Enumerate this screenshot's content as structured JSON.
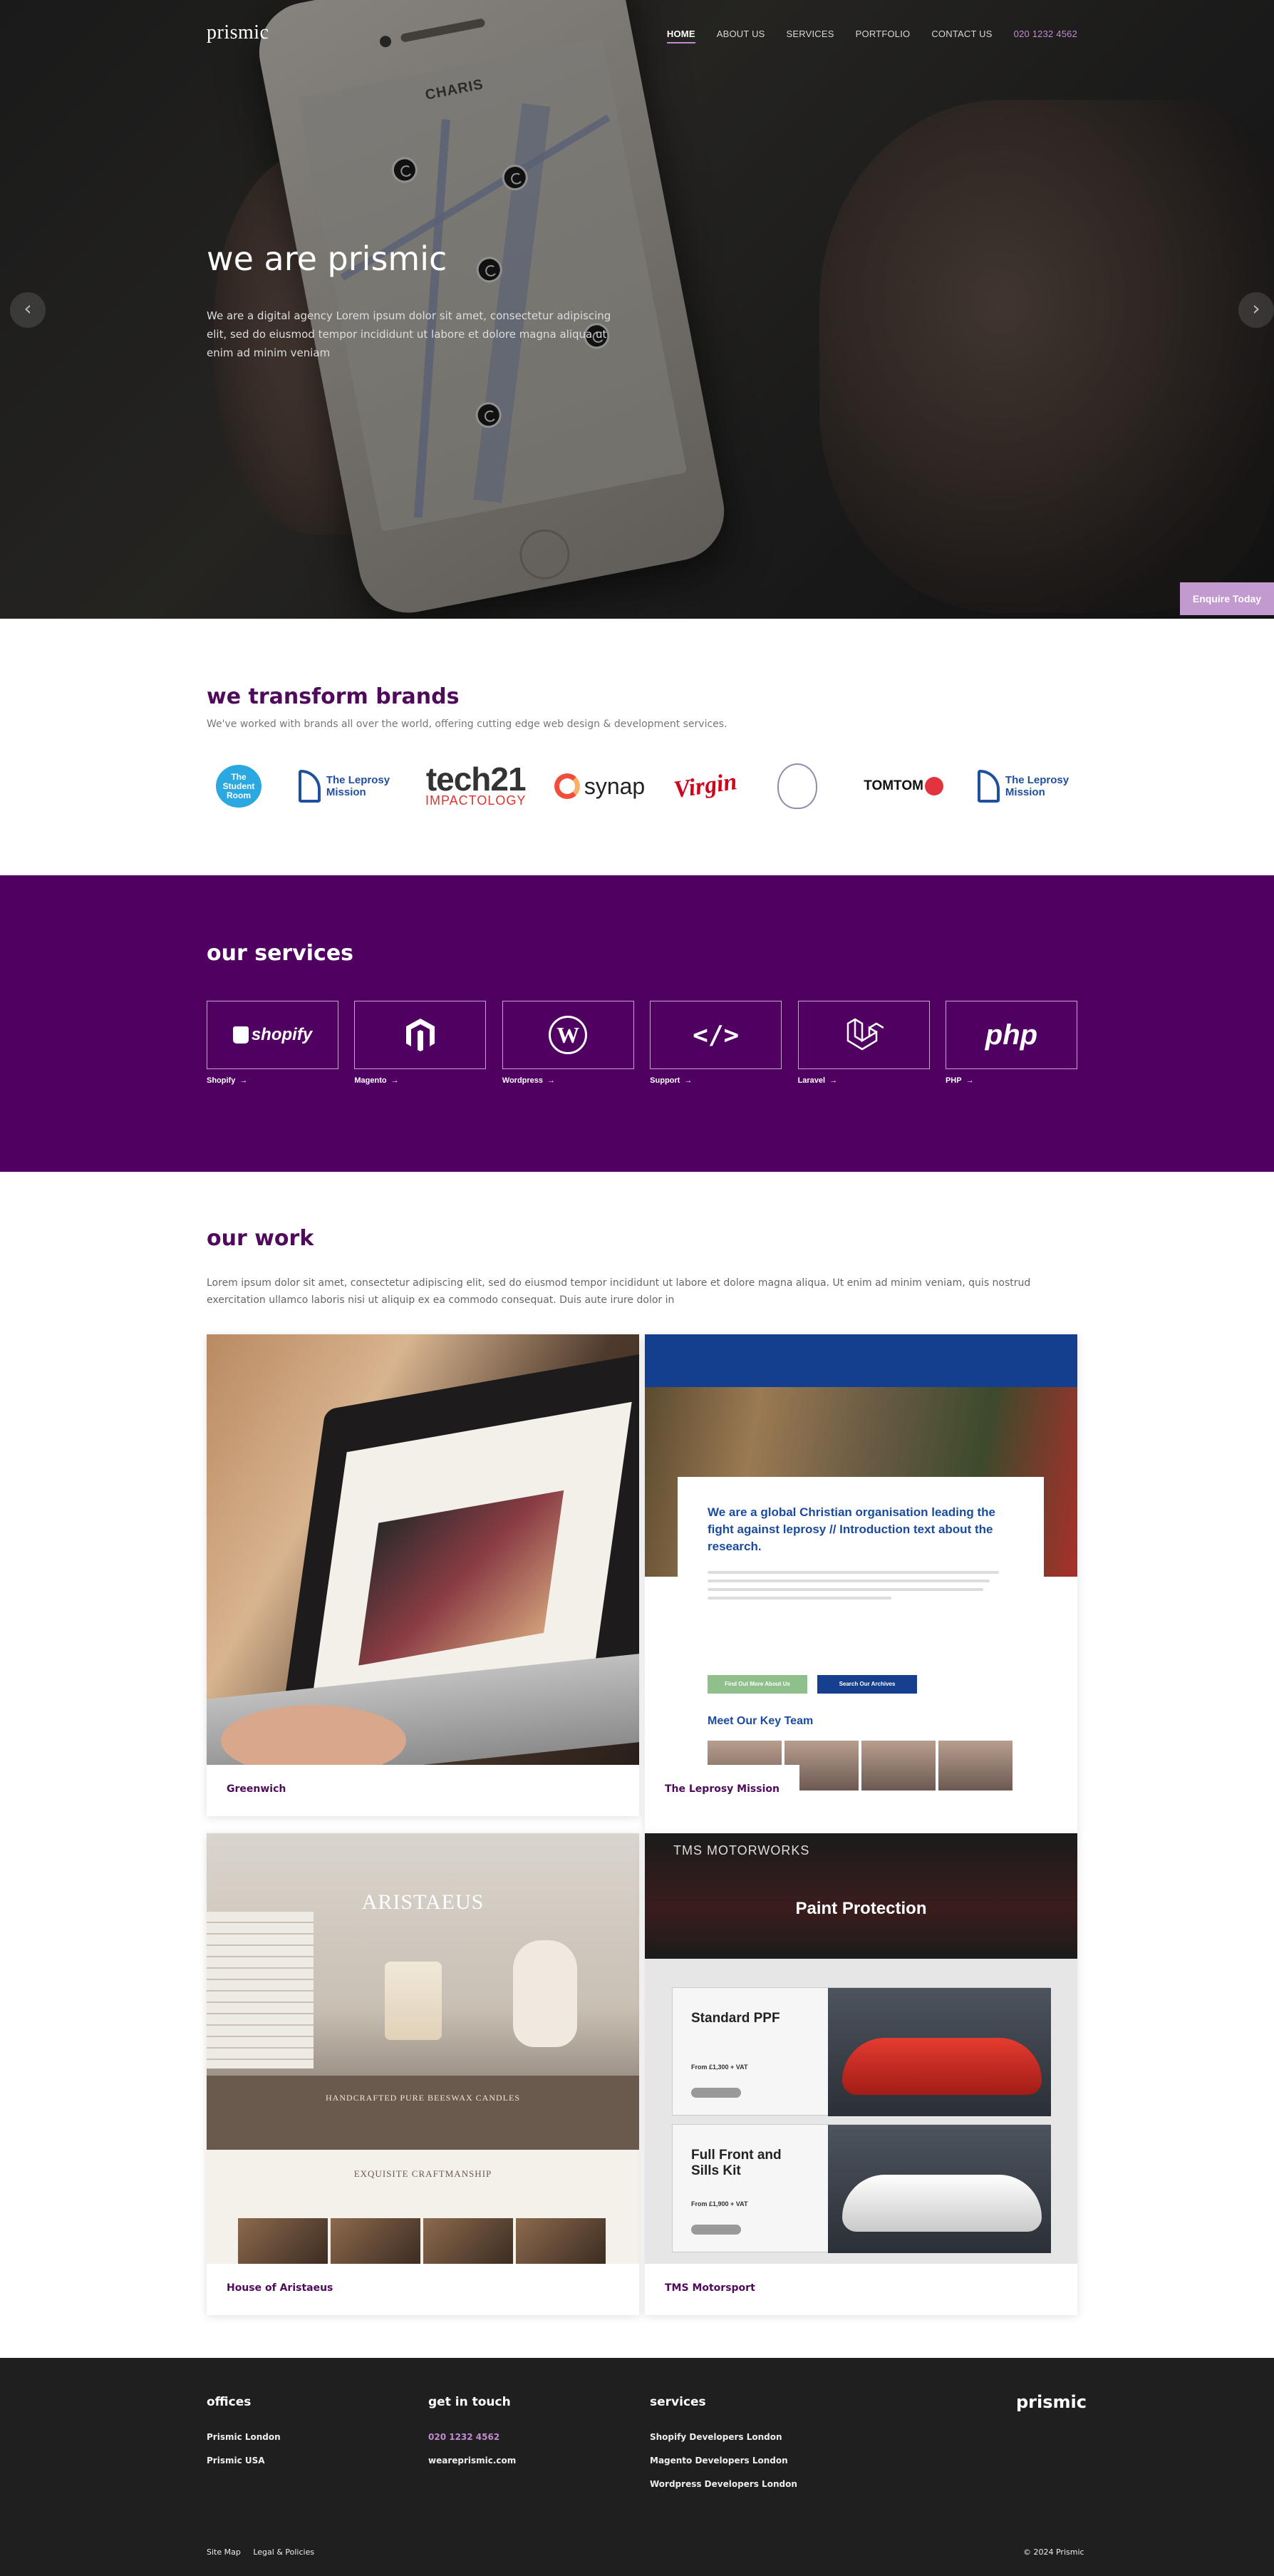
{
  "nav": {
    "logo": "prismic",
    "items": [
      {
        "label": "HOME",
        "active": true
      },
      {
        "label": "ABOUT US",
        "active": false
      },
      {
        "label": "SERVICES",
        "active": false
      },
      {
        "label": "PORTFOLIO",
        "active": false
      },
      {
        "label": "CONTACT US",
        "active": false
      }
    ],
    "phone": "020 1232 4562"
  },
  "hero": {
    "title": "we are prismic",
    "text": "We are a digital agency Lorem ipsum dolor sit amet, consectetur adipiscing elit, sed do eiusmod tempor incididunt ut labore et dolore magna aliqua ut enim ad minim veniam",
    "prev_icon": "chevron-left-icon",
    "next_icon": "chevron-right-icon",
    "phone_screen_title": "CHARIS",
    "enquire": "Enquire Today"
  },
  "brands": {
    "title": "we transform brands",
    "subtitle": "We've worked with brands all over the world, offering cutting edge web design & development services.",
    "logos": {
      "student_room": "The Student Room",
      "leprosy_a": "The Leprosy Mission",
      "tech21_main": "tech21",
      "tech21_sub": "IMPACTOLOGY",
      "synap": "synap",
      "virgin": "Virgin",
      "tomtom": "TOMTOM",
      "leprosy_b": "The Leprosy Mission"
    }
  },
  "services": {
    "title": "our services",
    "items": [
      {
        "label": "Shopify",
        "logo": "shopify"
      },
      {
        "label": "Magento",
        "logo": ""
      },
      {
        "label": "Wordpress",
        "logo": "W"
      },
      {
        "label": "Support",
        "logo": "</>"
      },
      {
        "label": "Laravel",
        "logo": ""
      },
      {
        "label": "PHP",
        "logo": "php"
      }
    ],
    "arrow": "→"
  },
  "work": {
    "title": "our work",
    "intro": "Lorem ipsum dolor sit amet, consectetur adipiscing elit, sed do eiusmod tempor incididunt ut labore et dolore magna aliqua. Ut enim ad minim veniam, quis nostrud exercitation ullamco laboris nisi ut aliquip ex ea commodo consequat. Duis aute irure dolor in",
    "projects": [
      {
        "name": "Greenwich"
      },
      {
        "name": "The Leprosy Mission",
        "panel_title": "We are a global Christian organisation leading the fight against leprosy // Introduction text about the research.",
        "btn_primary": "Find Out More About Us",
        "btn_secondary": "Search Our Archives",
        "team_title": "Meet Our Key Team"
      },
      {
        "name": "House of Aristaeus",
        "hero_title": "ARISTAEUS",
        "band_title": "HANDCRAFTED PURE BEESWAX CANDLES",
        "section_title": "EXQUISITE CRAFTMANSHIP"
      },
      {
        "name": "TMS Motorsport",
        "brand": "TMS MOTORWORKS",
        "heading": "Paint Protection",
        "rows": [
          {
            "title": "Standard PPF",
            "price": "From £1,300 + VAT"
          },
          {
            "title": "Full Front and Sills Kit",
            "price": "From £1,900 + VAT"
          }
        ]
      }
    ]
  },
  "footer": {
    "offices": {
      "title": "offices",
      "items": [
        "Prismic London",
        "Prismic USA"
      ]
    },
    "contact": {
      "title": "get in touch",
      "phone": "020 1232 4562",
      "web": "weareprismic.com"
    },
    "services": {
      "title": "services",
      "items": [
        "Shopify Developers London",
        "Magento Developers London",
        "Wordpress Developers London"
      ]
    },
    "logo": "prismic",
    "links": [
      "Site Map",
      "Legal & Policies"
    ],
    "copyright": "© 2024 Prismic"
  },
  "colors": {
    "brand_purple": "#4f0060",
    "accent_lilac": "#c28ad1",
    "footer": "#1f1f1f"
  }
}
